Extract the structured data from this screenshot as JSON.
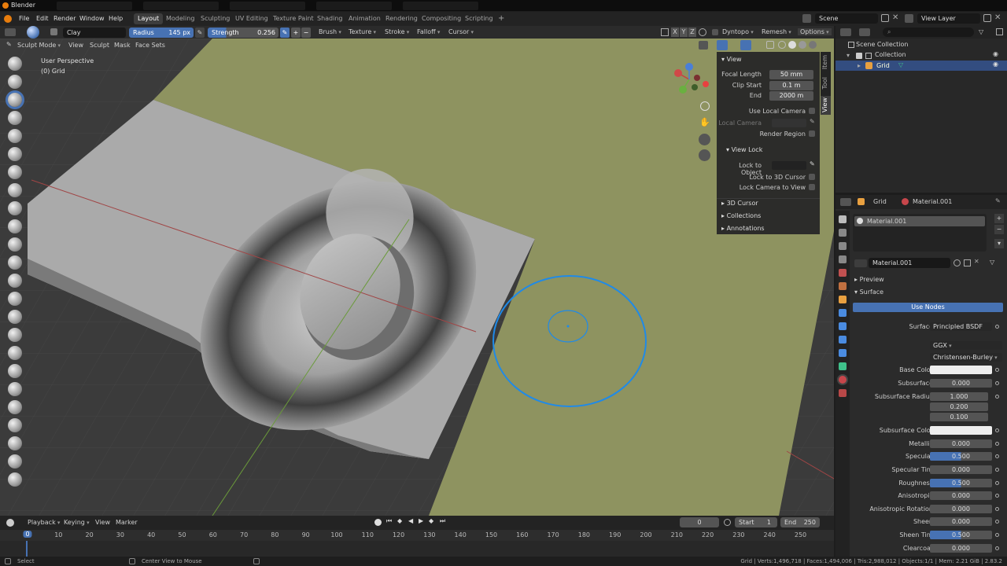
{
  "app": {
    "title": "Blender"
  },
  "menus": [
    "File",
    "Edit",
    "Render",
    "Window",
    "Help"
  ],
  "workspaces": [
    "Layout",
    "Modeling",
    "Sculpting",
    "UV Editing",
    "Texture Paint",
    "Shading",
    "Animation",
    "Rendering",
    "Compositing",
    "Scripting"
  ],
  "workspace_add": "+",
  "scene": {
    "name": "Scene",
    "view_layer": "View Layer"
  },
  "header": {
    "brush_name": "Clay",
    "radius_label": "Radius",
    "radius_value": "145 px",
    "strength_label": "Strength",
    "strength_value": "0.256",
    "menus": [
      "Brush",
      "Texture",
      "Stroke",
      "Falloff",
      "Cursor"
    ],
    "axes": [
      "X",
      "Y",
      "Z"
    ],
    "dyntopo": "Dyntopo",
    "remesh": "Remesh",
    "options": "Options"
  },
  "subheader": {
    "mode": "Sculpt Mode",
    "menus": [
      "View",
      "Sculpt",
      "Mask",
      "Face Sets"
    ]
  },
  "viewport": {
    "perspective": "User Perspective",
    "object": "(0) Grid"
  },
  "npanel": {
    "tabs": [
      "Item",
      "Tool",
      "View"
    ],
    "view_title": "View",
    "focal_length_label": "Focal Length",
    "focal_length": "50 mm",
    "clip_start_label": "Clip Start",
    "clip_start": "0.1 m",
    "end_label": "End",
    "end": "2000 m",
    "use_local_camera": "Use Local Camera",
    "local_camera": "Local Camera",
    "render_region": "Render Region",
    "view_lock_title": "View Lock",
    "lock_to_object": "Lock to Object",
    "lock_to_3d_cursor": "Lock to 3D Cursor",
    "lock_camera_to_view": "Lock Camera to View",
    "cursor_3d": "3D Cursor",
    "collections": "Collections",
    "annotations": "Annotations"
  },
  "outliner": {
    "scene_collection": "Scene Collection",
    "collection": "Collection",
    "grid": "Grid"
  },
  "properties": {
    "object": "Grid",
    "material": "Material.001",
    "slot": "Material.001",
    "datablock": "Material.001",
    "preview": "Preview",
    "surface_section": "Surface",
    "use_nodes": "Use Nodes",
    "surface_label": "Surface",
    "surface_value": "Principled BSDF",
    "distribution": "GGX",
    "subsurface_method": "Christensen-Burley",
    "fields": [
      {
        "label": "Base Color",
        "value": "",
        "type": "color"
      },
      {
        "label": "Subsurface",
        "value": "0.000"
      },
      {
        "label": "Subsurface Radius",
        "value": "1.000"
      },
      {
        "label": "",
        "value": "0.200"
      },
      {
        "label": "",
        "value": "0.100"
      },
      {
        "label": "Subsurface Color",
        "value": "",
        "type": "color"
      },
      {
        "label": "Metallic",
        "value": "0.000"
      },
      {
        "label": "Specular",
        "value": "0.500",
        "type": "slider"
      },
      {
        "label": "Specular Tint",
        "value": "0.000"
      },
      {
        "label": "Roughness",
        "value": "0.500",
        "type": "slider"
      },
      {
        "label": "Anisotropic",
        "value": "0.000"
      },
      {
        "label": "Anisotropic Rotation",
        "value": "0.000"
      },
      {
        "label": "Sheen",
        "value": "0.000"
      },
      {
        "label": "Sheen Tint",
        "value": "0.500",
        "type": "slider"
      },
      {
        "label": "Clearcoat",
        "value": "0.000"
      }
    ]
  },
  "timeline": {
    "menus": [
      "Playback",
      "Keying",
      "View",
      "Marker"
    ],
    "current_frame": "0",
    "start_label": "Start",
    "start": "1",
    "end_label": "End",
    "end": "250",
    "ticks": [
      "0",
      "10",
      "20",
      "30",
      "40",
      "50",
      "60",
      "70",
      "80",
      "90",
      "100",
      "110",
      "120",
      "130",
      "140",
      "150",
      "160",
      "170",
      "180",
      "190",
      "200",
      "210",
      "220",
      "230",
      "240",
      "250"
    ]
  },
  "statusbar": {
    "left": "Select",
    "middle": "Center View to Mouse",
    "right": "Grid | Verts:1,496,718 | Faces:1,494,006 | Tris:2,988,012 | Objects:1/1 | Mem: 2.21 GiB | 2.83.2"
  },
  "colors": {
    "accent": "#4772b3",
    "ground_plane": "#8e9360",
    "sculpt_mesh": "#9a9a9a",
    "brush_circle": "#1f8ae8",
    "grid": "#3b3b3b"
  }
}
